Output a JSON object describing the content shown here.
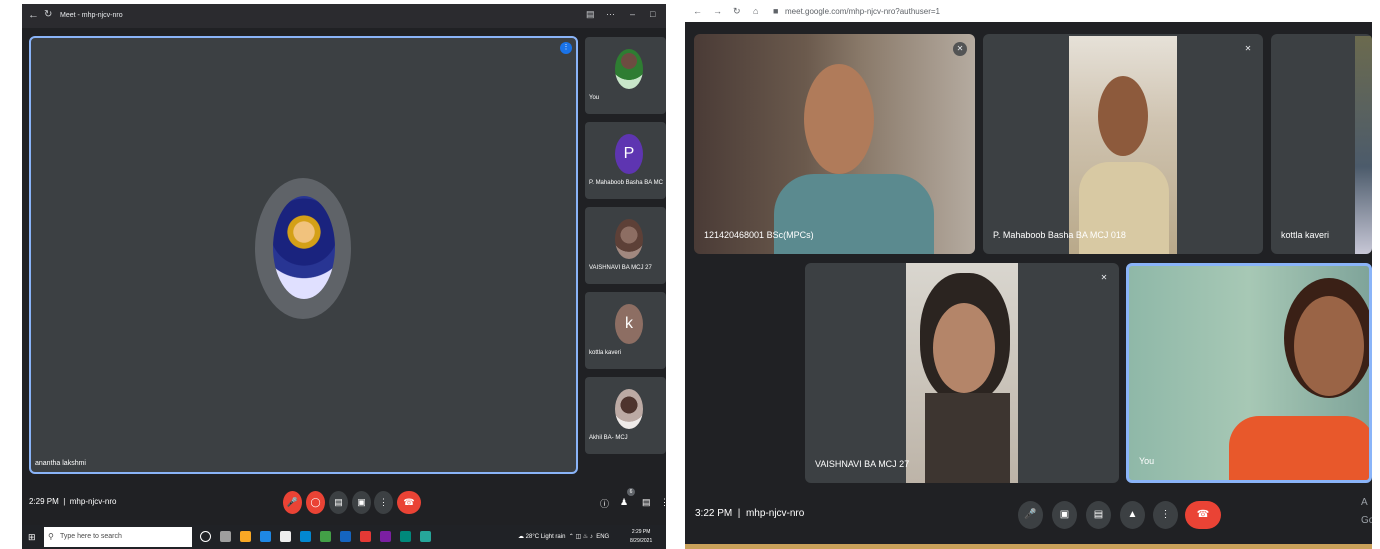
{
  "left": {
    "window_title": "Meet - mhp-njcv-nro",
    "main_tile_name": "anantha lakshmi",
    "side_tiles": [
      {
        "label": "You",
        "letter": ""
      },
      {
        "label": "P. Mahaboob Basha BA MC",
        "letter": "P"
      },
      {
        "label": "VAISHNAVI BA MCJ 27",
        "letter": ""
      },
      {
        "label": "kottla kaveri",
        "letter": "k"
      },
      {
        "label": "Akhil BA- MCJ",
        "letter": ""
      }
    ],
    "clock": "2:29 PM",
    "meeting_code": "mhp-njcv-nro",
    "people_count": "6",
    "taskbar": {
      "search_placeholder": "Type here to search",
      "weather": "28°C Light rain",
      "lang": "ENG",
      "time": "2:29 PM",
      "date": "8/29/2021"
    }
  },
  "right": {
    "url": "meet.google.com/mhp-njcv-nro?authuser=1",
    "tiles": [
      {
        "name": "121420468001 BSc(MPCs)"
      },
      {
        "name": "P. Mahaboob Basha BA MCJ 018"
      },
      {
        "name": "kottla kaveri"
      },
      {
        "name": "VAISHNAVI BA MCJ 27"
      },
      {
        "name": "You"
      }
    ],
    "clock": "3:22 PM",
    "meeting_code": "mhp-njcv-nro",
    "edge_text": "A",
    "edge_text2": "Go"
  },
  "colors": {
    "meet_bg": "#202124",
    "tile_bg": "#3c4043",
    "accent_blue": "#8ab4f8",
    "end_call_red": "#ea4335"
  },
  "icons": {
    "mic_off": "mic-off-icon",
    "cam_off": "camera-off-icon",
    "captions": "captions-icon",
    "present": "present-icon",
    "more": "more-vert-icon",
    "end_call": "end-call-icon",
    "info": "info-icon",
    "people": "people-icon",
    "chat": "chat-icon"
  }
}
